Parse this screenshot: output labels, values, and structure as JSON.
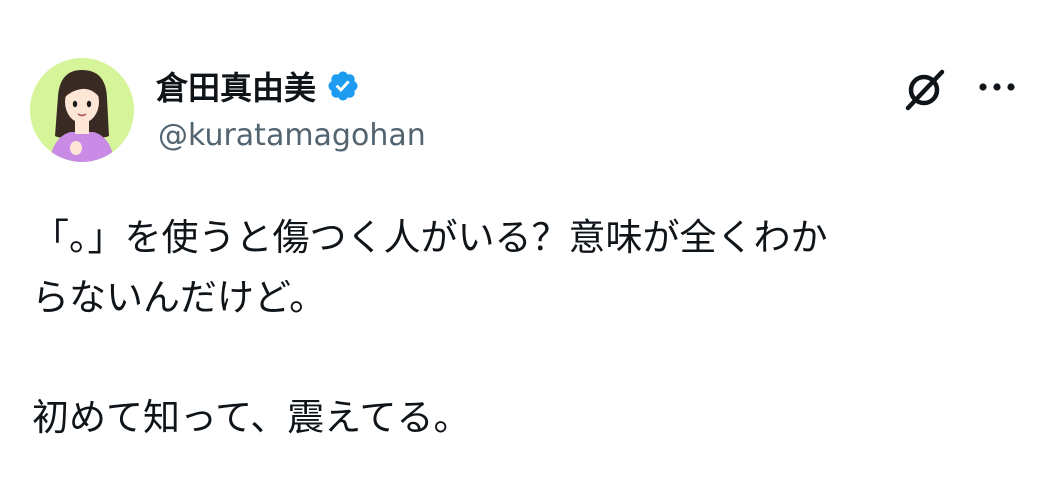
{
  "author": {
    "display_name": "倉田真由美",
    "handle": "@kuratamagohan",
    "verified": true,
    "avatar_icon": "avatar-illustration-woman",
    "verified_icon": "verified-badge-icon",
    "verified_color": "#1d9bf0"
  },
  "actions": {
    "grok_icon": "grok-icon",
    "more_icon": "more-options-icon"
  },
  "tweet": {
    "lines": [
      "「。」を使うと傷つく人がいる？意味が全くわか",
      "らないんだけど。",
      "初めて知って、震えてる。"
    ]
  },
  "colors": {
    "text_primary": "#0f1419",
    "text_secondary": "#536471",
    "avatar_background": "#d6f59a"
  }
}
